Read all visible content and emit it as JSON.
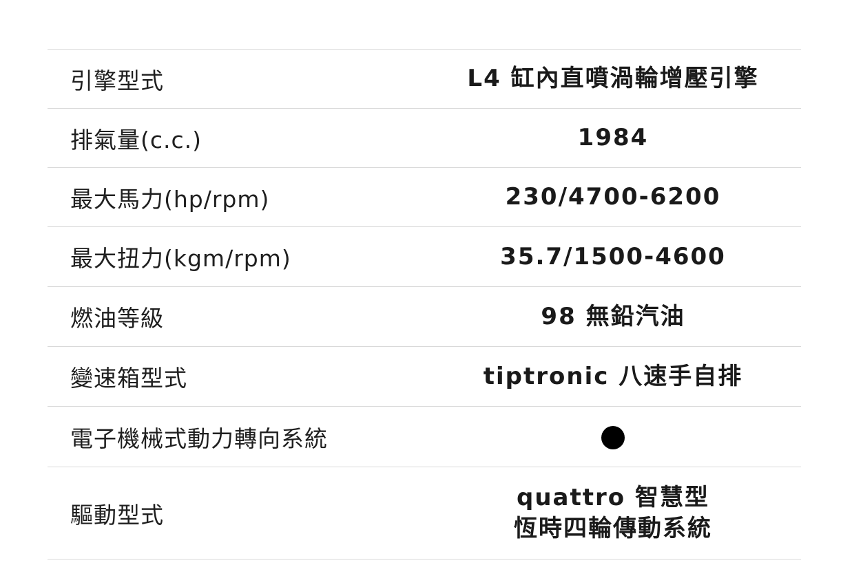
{
  "specs": [
    {
      "label": "引擎型式",
      "value": "L4 缸內直噴渦輪增壓引擎"
    },
    {
      "label": "排氣量(c.c.)",
      "value": "1984"
    },
    {
      "label": "最大馬力(hp/rpm)",
      "value": "230/4700-6200"
    },
    {
      "label": "最大扭力(kgm/rpm)",
      "value": "35.7/1500-4600"
    },
    {
      "label": "燃油等級",
      "value": "98 無鉛汽油"
    },
    {
      "label": "變速箱型式",
      "value": "tiptronic 八速手自排"
    },
    {
      "label": "電子機械式動力轉向系統",
      "value": "●",
      "value_icon": "filled-circle"
    },
    {
      "label": "驅動型式",
      "value_lines": [
        "quattro 智慧型",
        "恆時四輪傳動系統"
      ]
    }
  ]
}
